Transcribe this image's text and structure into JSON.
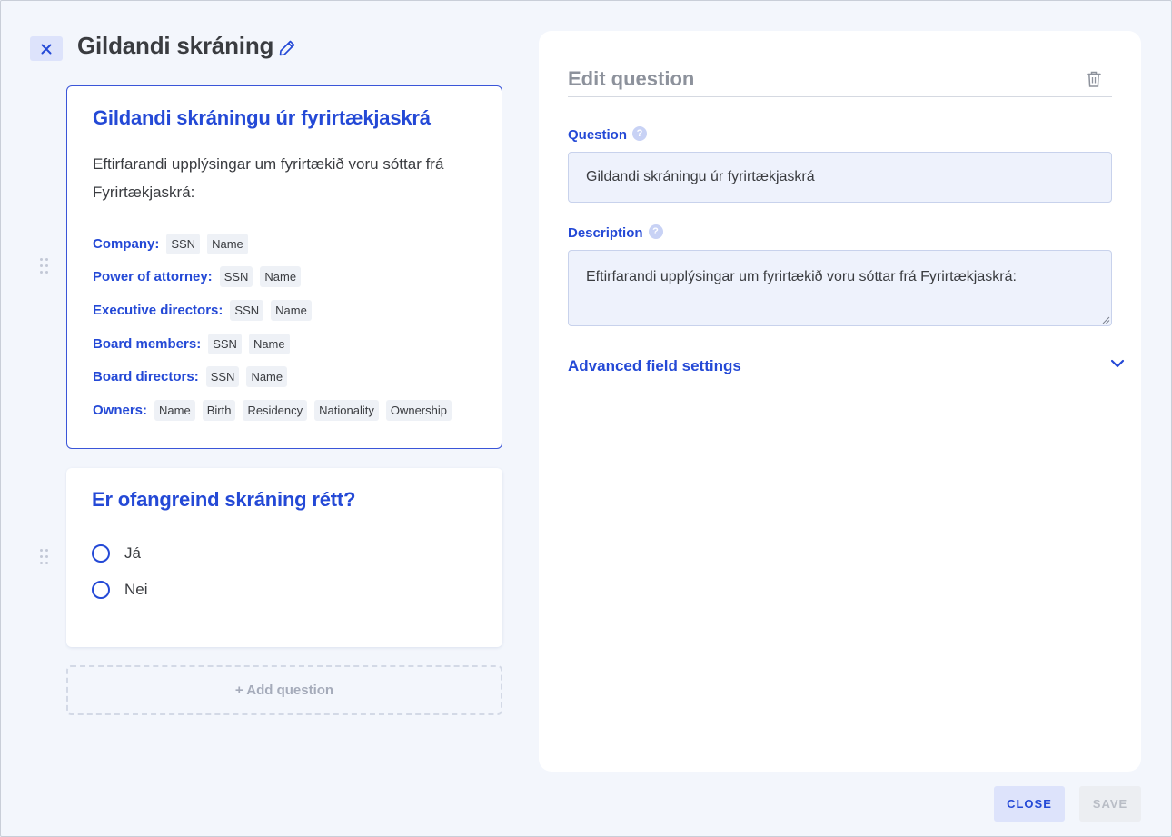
{
  "header": {
    "title": "Gildandi skráning"
  },
  "cards": {
    "registration": {
      "title": "Gildandi skráningu úr fyrirtækjaskrá",
      "description": "Eftirfarandi upplýsingar um fyrirtækið voru sóttar frá Fyrirtækjaskrá:",
      "rows": [
        {
          "label": "Company:",
          "chips": [
            "SSN",
            "Name"
          ]
        },
        {
          "label": "Power of attorney:",
          "chips": [
            "SSN",
            "Name"
          ]
        },
        {
          "label": "Executive directors:",
          "chips": [
            "SSN",
            "Name"
          ]
        },
        {
          "label": "Board members:",
          "chips": [
            "SSN",
            "Name"
          ]
        },
        {
          "label": "Board directors:",
          "chips": [
            "SSN",
            "Name"
          ]
        },
        {
          "label": "Owners:",
          "chips": [
            "Name",
            "Birth",
            "Residency",
            "Nationality",
            "Ownership"
          ]
        }
      ]
    },
    "confirm": {
      "title": "Er ofangreind skráning rétt?",
      "options": [
        "Já",
        "Nei"
      ]
    }
  },
  "add_question_label": "+ Add question",
  "editor": {
    "title": "Edit question",
    "question_label": "Question",
    "question_value": "Gildandi skráningu úr fyrirtækjaskrá",
    "description_label": "Description",
    "description_value": "Eftirfarandi upplýsingar um fyrirtækið voru sóttar frá Fyrirtækjaskrá:",
    "help_glyph": "?",
    "advanced_label": "Advanced field settings"
  },
  "footer": {
    "close_label": "CLOSE",
    "save_label": "SAVE"
  },
  "colors": {
    "accent": "#2449d6",
    "background": "#f3f6fc",
    "chip_bg": "#eef1f6",
    "input_bg": "#eef2fc"
  }
}
